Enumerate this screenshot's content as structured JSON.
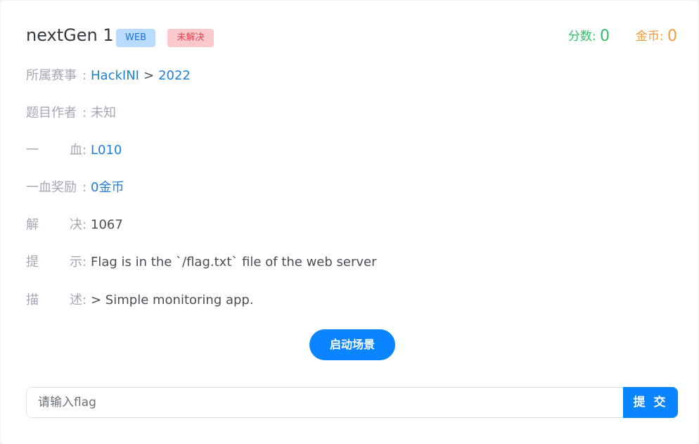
{
  "challenge": {
    "title": "nextGen 1",
    "category_tag": "WEB",
    "status_tag": "未解决"
  },
  "stats": {
    "score_label": "分数:",
    "score_value": "0",
    "coin_label": "金币:",
    "coin_value": "0"
  },
  "details": {
    "event": {
      "label": "所属赛事",
      "competition": "HackINI",
      "separator": ">",
      "year": "2022"
    },
    "author": {
      "label": "题目作者",
      "value": "未知"
    },
    "first_blood": {
      "label_a": "一",
      "label_b": "血",
      "value": "L010"
    },
    "first_blood_reward": {
      "label": "一血奖励",
      "value": "0金币"
    },
    "solves": {
      "label_a": "解",
      "label_b": "决",
      "value": "1067"
    },
    "hint": {
      "label_a": "提",
      "label_b": "示",
      "value": "Flag is in the `/flag.txt` file of the web server"
    },
    "description": {
      "label_a": "描",
      "label_b": "述",
      "value": "> Simple monitoring app."
    },
    "colon": ":"
  },
  "actions": {
    "start_label": "启动场景",
    "flag_placeholder": "请输入flag",
    "flag_value": "",
    "submit_label": "提 交"
  },
  "colors": {
    "primary": "#0a84ff",
    "score": "#2fbf6a",
    "coin": "#f59b3d",
    "link": "#1f7fdc",
    "tag_web_bg": "#b8dbff",
    "tag_unsolved_bg": "#f9c9cc"
  }
}
